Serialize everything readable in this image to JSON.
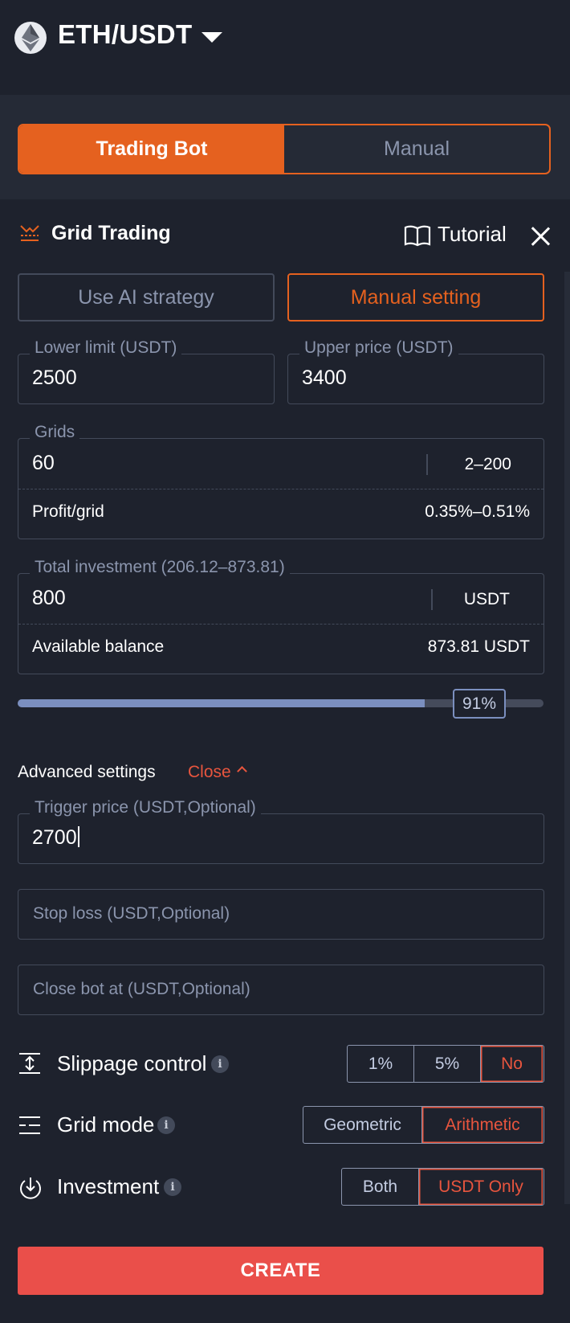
{
  "header": {
    "pair": "ETH/USDT",
    "logo_icon": "ethereum-icon",
    "dropdown_icon": "caret-down-icon"
  },
  "mode_tabs": [
    {
      "label": "Trading Bot",
      "active": true
    },
    {
      "label": "Manual",
      "active": false
    }
  ],
  "strategy": {
    "title": "Grid Trading",
    "tutorial_label": "Tutorial"
  },
  "strategy_tabs": [
    {
      "label": "Use AI strategy",
      "active": false
    },
    {
      "label": "Manual setting",
      "active": true
    }
  ],
  "fields": {
    "lower_limit": {
      "label": "Lower limit (USDT)",
      "value": "2500"
    },
    "upper_price": {
      "label": "Upper price (USDT)",
      "value": "3400"
    },
    "grids": {
      "label": "Grids",
      "value": "60",
      "range": "2–200",
      "sub_label": "Profit/grid",
      "sub_value": "0.35%–0.51%"
    },
    "investment": {
      "label": "Total investment (206.12–873.81)",
      "value": "800",
      "unit": "USDT",
      "sub_label": "Available balance",
      "sub_value": "873.81 USDT"
    }
  },
  "slider": {
    "percent": 91,
    "percent_label": "91%"
  },
  "advanced": {
    "label": "Advanced settings",
    "toggle_label": "Close",
    "trigger_price": {
      "label": "Trigger price (USDT,Optional)",
      "value": "2700"
    },
    "stop_loss": {
      "placeholder": "Stop loss (USDT,Optional)"
    },
    "close_bot_at": {
      "placeholder": "Close bot at (USDT,Optional)"
    }
  },
  "options": {
    "slippage": {
      "label": "Slippage control",
      "choices": [
        "1%",
        "5%",
        "No"
      ],
      "selected": "No"
    },
    "grid_mode": {
      "label": "Grid mode",
      "choices": [
        "Geometric",
        "Arithmetic"
      ],
      "selected": "Arithmetic"
    },
    "investment": {
      "label": "Investment",
      "choices": [
        "Both",
        "USDT Only"
      ],
      "selected": "USDT Only"
    }
  },
  "create_label": "CREATE",
  "colors": {
    "accent": "#e5611f",
    "danger": "#ea4f4a",
    "background": "#1e222d",
    "panel": "#252a36"
  }
}
